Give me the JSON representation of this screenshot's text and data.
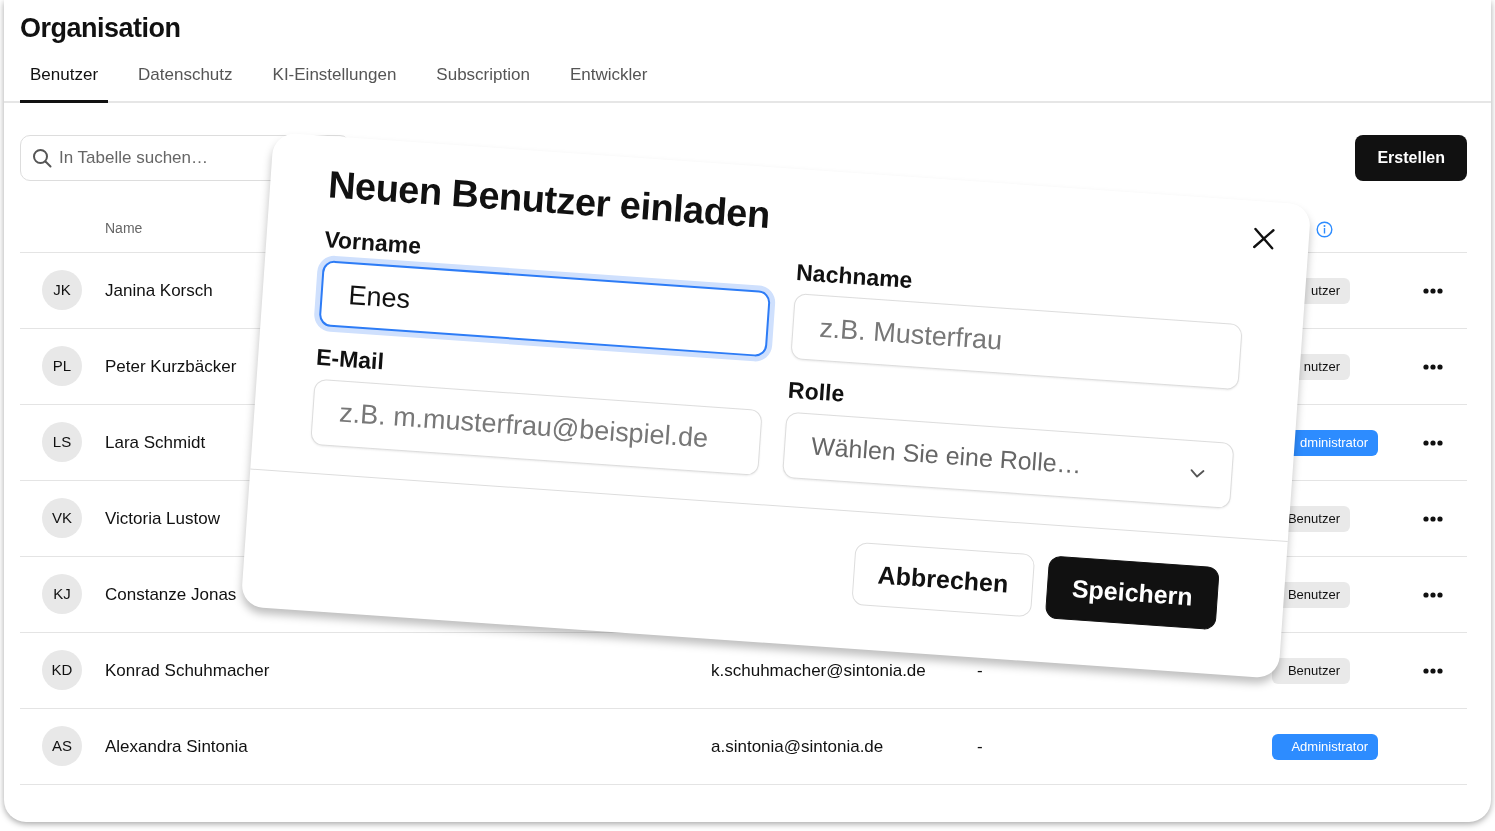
{
  "page": {
    "title": "Organisation"
  },
  "tabs": [
    {
      "label": "Benutzer",
      "selected": true
    },
    {
      "label": "Datenschutz",
      "selected": false
    },
    {
      "label": "KI-Einstellungen",
      "selected": false
    },
    {
      "label": "Subscription",
      "selected": false
    },
    {
      "label": "Entwickler",
      "selected": false
    }
  ],
  "search": {
    "placeholder": "In Tabelle suchen…"
  },
  "create_button": "Erstellen",
  "table": {
    "columns": [
      {
        "label": "Name"
      }
    ],
    "rows": [
      {
        "initials": "JK",
        "name": "Janina Korsch",
        "role": "utzer",
        "kind": "user",
        "actions": true
      },
      {
        "initials": "PL",
        "name": "Peter Kurzbäcker",
        "role": "nutzer",
        "kind": "user",
        "actions": true
      },
      {
        "initials": "LS",
        "name": "Lara Schmidt",
        "role": "dministrator",
        "kind": "admin",
        "actions": true
      },
      {
        "initials": "VK",
        "name": "Victoria Lustow",
        "role": "Benutzer",
        "kind": "user",
        "actions": true
      },
      {
        "initials": "KJ",
        "name": "Constanze Jonas",
        "role": "Benutzer",
        "kind": "user",
        "actions": true
      },
      {
        "initials": "KD",
        "name": "Konrad Schuhmacher",
        "email": "k.schuhmacher@sintonia.de",
        "column_4": "-",
        "role": "Benutzer",
        "kind": "user",
        "actions": true
      },
      {
        "initials": "AS",
        "name": "Alexandra Sintonia",
        "email": "a.sintonia@sintonia.de",
        "column_4": "-",
        "role": "Administrator",
        "kind": "admin",
        "actions": false
      }
    ]
  },
  "dialog": {
    "title": "Neuen Benutzer einladen",
    "fields": [
      {
        "label": "Vorname",
        "kind": "text",
        "value": "Enes",
        "focused": true
      },
      {
        "label": "Nachname",
        "kind": "text",
        "placeholder": "z.B. Musterfrau",
        "focused": false
      },
      {
        "label": "E-Mail",
        "kind": "text",
        "placeholder": "z.B. m.musterfrau@beispiel.de",
        "focused": false
      },
      {
        "label": "Rolle",
        "kind": "select",
        "placeholder": "Wählen Sie eine Rolle…",
        "focused": false
      }
    ],
    "buttons": [
      {
        "label": "Abbrechen",
        "kind": "secondary"
      },
      {
        "label": "Speichern",
        "kind": "primary"
      }
    ]
  }
}
